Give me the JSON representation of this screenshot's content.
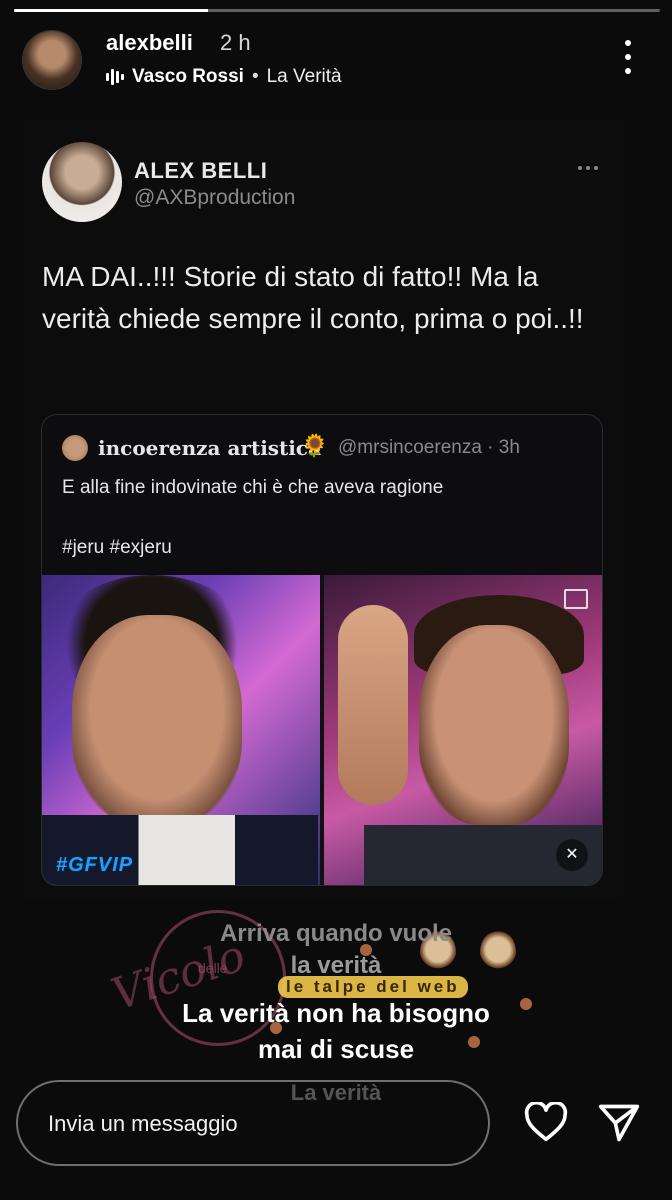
{
  "story": {
    "progress": 0.3,
    "username": "alexbelli",
    "time": "2 h",
    "music": {
      "artist": "Vasco Rossi",
      "separator": "•",
      "song": "La Verità"
    }
  },
  "tweet": {
    "name": "ALEX BELLI",
    "handle": "@AXBproduction",
    "text": "MA DAI..!!!  Storie di stato di fatto!! Ma la verità chiede sempre il conto, prima o poi..!!",
    "quote": {
      "name": "incoerenza artistica",
      "emoji": "🌻",
      "meta": "@mrsincoerenza · 3h",
      "text": "E alla fine indovinate chi è che aveva ragione",
      "tags": "#jeru #exjeru",
      "media_badge": "#GFVIP"
    }
  },
  "lyrics": {
    "line1": "Arriva quando vuole",
    "line2": "la verità",
    "line3": "La verità non ha bisogno",
    "line4": "mai di scuse",
    "line5": "La verità"
  },
  "watermarks": {
    "vicolo": "Vicolo",
    "vicolo_sub": "delle",
    "talpe": "le talpe del web"
  },
  "reply": {
    "placeholder": "Invia un messaggio"
  },
  "icons": {
    "more": "more-vertical-icon",
    "music": "music-bars-icon",
    "heart": "heart-icon",
    "send": "send-icon"
  }
}
